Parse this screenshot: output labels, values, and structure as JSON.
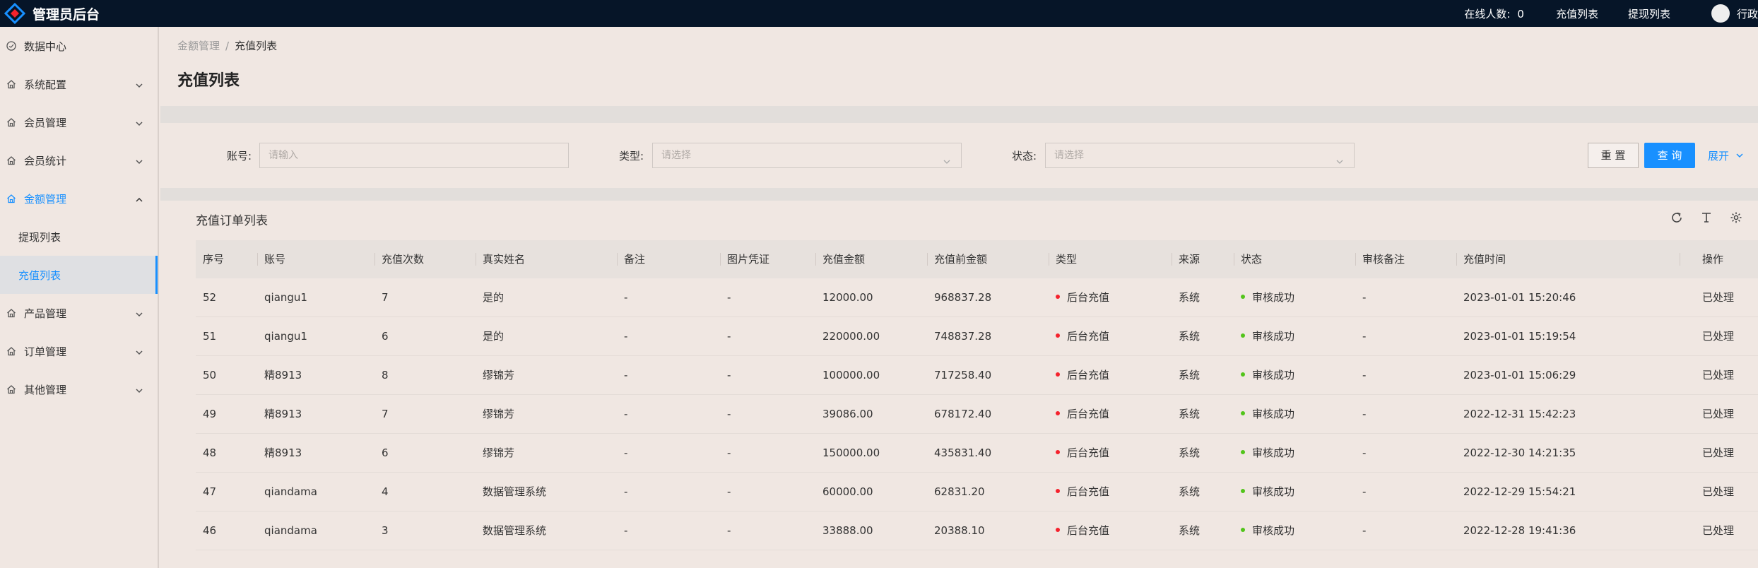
{
  "header": {
    "title": "管理员后台",
    "online_label": "在线人数:",
    "online_count": "0",
    "links": [
      "充值列表",
      "提现列表"
    ],
    "user_name": "行政"
  },
  "sidebar": {
    "items": [
      {
        "label": "数据中心",
        "icon": "dashboard-icon"
      },
      {
        "label": "系统配置",
        "icon": "home-icon"
      },
      {
        "label": "会员管理",
        "icon": "home-icon"
      },
      {
        "label": "会员统计",
        "icon": "home-icon"
      },
      {
        "label": "金额管理",
        "icon": "home-icon"
      },
      {
        "label": "产品管理",
        "icon": "home-icon"
      },
      {
        "label": "订单管理",
        "icon": "home-icon"
      },
      {
        "label": "其他管理",
        "icon": "home-icon"
      }
    ],
    "subitems": [
      {
        "label": "提现列表"
      },
      {
        "label": "充值列表"
      }
    ]
  },
  "breadcrumb": {
    "parent": "金额管理",
    "separator": "/",
    "current": "充值列表"
  },
  "page_title": "充值列表",
  "search": {
    "account_label": "账号:",
    "account_placeholder": "请输入",
    "type_label": "类型:",
    "type_placeholder": "请选择",
    "status_label": "状态:",
    "status_placeholder": "请选择",
    "reset_label": "重 置",
    "query_label": "查 询",
    "expand_label": "展开"
  },
  "table": {
    "title": "充值订单列表",
    "columns": [
      "序号",
      "账号",
      "充值次数",
      "真实姓名",
      "备注",
      "图片凭证",
      "充值金额",
      "充值前金额",
      "类型",
      "来源",
      "状态",
      "审核备注",
      "充值时间",
      "操作"
    ],
    "rows": [
      [
        "52",
        "qiangu1",
        "7",
        "是的",
        "-",
        "-",
        "12000.00",
        "968837.28",
        "后台充值",
        "系统",
        "审核成功",
        "-",
        "2023-01-01 15:20:46",
        "已处理"
      ],
      [
        "51",
        "qiangu1",
        "6",
        "是的",
        "-",
        "-",
        "220000.00",
        "748837.28",
        "后台充值",
        "系统",
        "审核成功",
        "-",
        "2023-01-01 15:19:54",
        "已处理"
      ],
      [
        "50",
        "精8913",
        "8",
        "缪锦芳",
        "-",
        "-",
        "100000.00",
        "717258.40",
        "后台充值",
        "系统",
        "审核成功",
        "-",
        "2023-01-01 15:06:29",
        "已处理"
      ],
      [
        "49",
        "精8913",
        "7",
        "缪锦芳",
        "-",
        "-",
        "39086.00",
        "678172.40",
        "后台充值",
        "系统",
        "审核成功",
        "-",
        "2022-12-31 15:42:23",
        "已处理"
      ],
      [
        "48",
        "精8913",
        "6",
        "缪锦芳",
        "-",
        "-",
        "150000.00",
        "435831.40",
        "后台充值",
        "系统",
        "审核成功",
        "-",
        "2022-12-30 14:21:35",
        "已处理"
      ],
      [
        "47",
        "qiandama",
        "4",
        "数据管理系统",
        "-",
        "-",
        "60000.00",
        "62831.20",
        "后台充值",
        "系统",
        "审核成功",
        "-",
        "2022-12-29 15:54:21",
        "已处理"
      ],
      [
        "46",
        "qiandama",
        "3",
        "数据管理系统",
        "-",
        "-",
        "33888.00",
        "20388.10",
        "后台充值",
        "系统",
        "审核成功",
        "-",
        "2022-12-28 19:41:36",
        "已处理"
      ]
    ]
  },
  "colors": {
    "header_bg": "#061528",
    "accent": "#1890ff",
    "type_dot": "#f5222d",
    "status_dot": "#52c41a"
  }
}
